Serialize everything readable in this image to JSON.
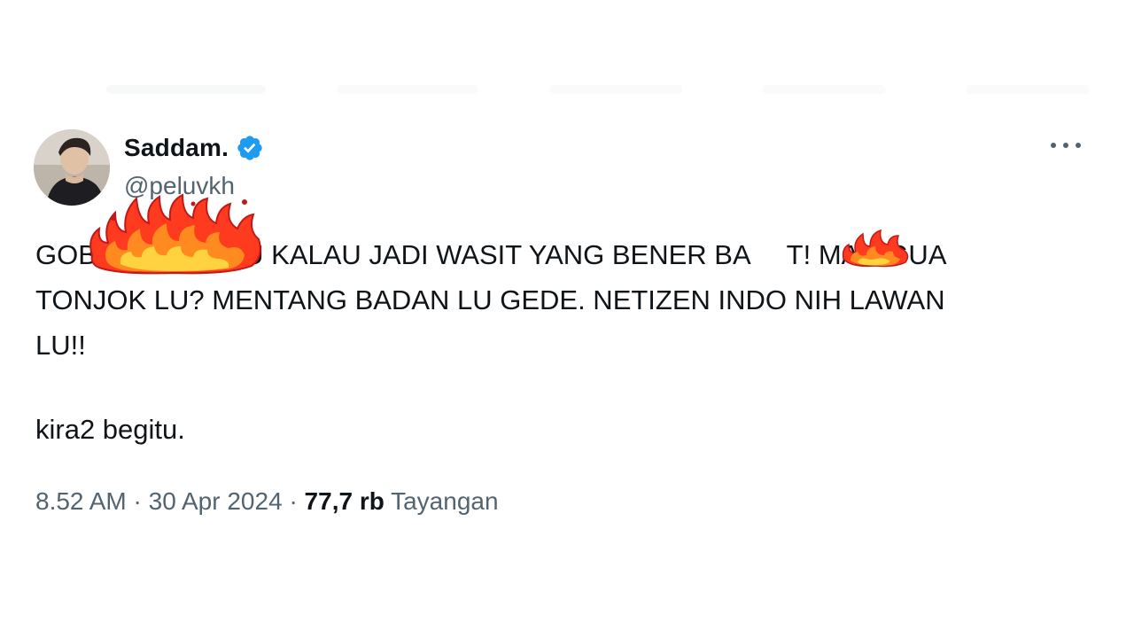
{
  "author": {
    "display_name": "Saddam.",
    "handle": "@peluvkh",
    "verified": true,
    "verified_color": "#1d9bf0"
  },
  "tweet": {
    "text": "GOBLOK LU KALAU JADI WASIT YANG BENER BANGSAT! MAU GUA TONJOK LU? MENTANG BADAN LU GEDE. NETIZEN INDO NIH LAWAN LU!!",
    "text_visible_line1": "GOB",
    "text_visible_line1b": "U LU KALAU JADI WASIT YANG BENER BA",
    "text_visible_line1c": "T! MAU GUA",
    "text_visible_line2": "TONJOK LU? MENTANG BADAN LU GEDE. NETIZEN INDO NIH LAWAN",
    "text_visible_line3": "LU!!",
    "second_paragraph": "kira2 begitu."
  },
  "meta": {
    "time": "8.52 AM",
    "separator": "·",
    "date": "30 Apr 2024",
    "views_count": "77,7 rb",
    "views_label": "Tayangan"
  },
  "icons": {
    "more": "more-options-icon",
    "verified": "verified-badge-icon",
    "censor": "fire-censor-icon"
  },
  "colors": {
    "text": "#0f1419",
    "secondary": "#536471",
    "flame_outer": "#ff3b1f",
    "flame_inner": "#ffd23f"
  }
}
